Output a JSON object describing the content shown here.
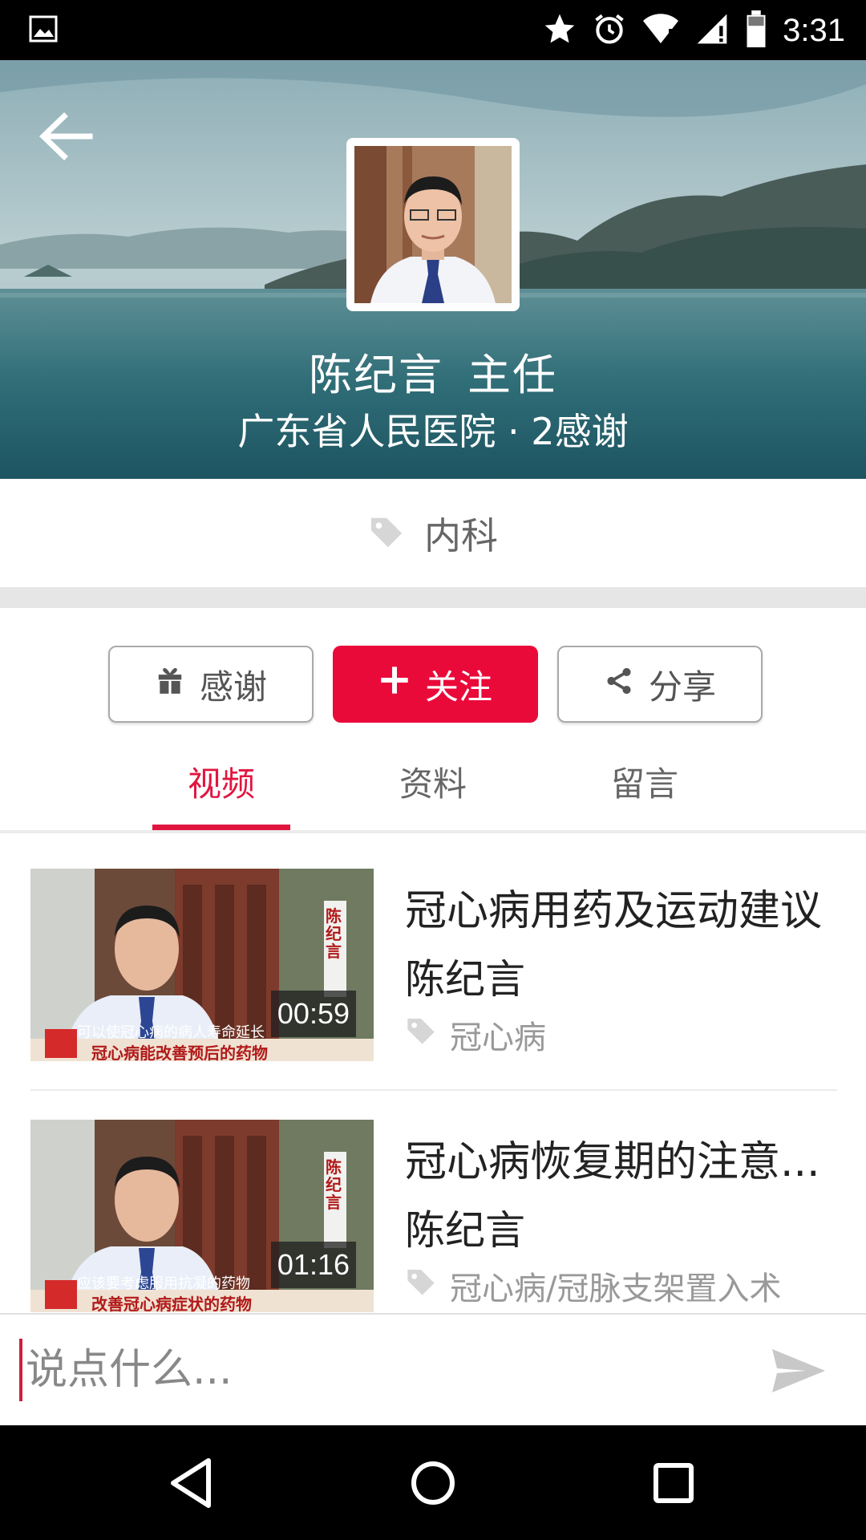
{
  "status_bar": {
    "time": "3:31",
    "icons": [
      "image-icon",
      "star-icon",
      "alarm-icon",
      "wifi-icon",
      "signal-icon",
      "battery-icon"
    ]
  },
  "header": {
    "doctor_name": "陈纪言",
    "doctor_title": "主任",
    "hospital": "广东省人民医院",
    "separator": "·",
    "thanks_count": "2感谢"
  },
  "department": {
    "label": "内科",
    "icon": "tag-icon"
  },
  "actions": {
    "thank_label": "感谢",
    "follow_label": "关注",
    "share_label": "分享"
  },
  "tabs": [
    {
      "label": "视频",
      "active": true
    },
    {
      "label": "资料",
      "active": false
    },
    {
      "label": "留言",
      "active": false
    }
  ],
  "videos": [
    {
      "title": "冠心病用药及运动建议",
      "author": "陈纪言",
      "tag": "冠心病",
      "duration": "00:59",
      "caption_top": "可以使冠心病的病人寿命延长",
      "caption_bottom": "冠心病能改善预后的药物",
      "side_text": "陈纪言"
    },
    {
      "title": "冠心病恢复期的注意...",
      "author": "陈纪言",
      "tag": "冠心病/冠脉支架置入术",
      "duration": "01:16",
      "caption_top": "应该要考虑服用抗凝的药物",
      "caption_bottom": "改善冠心病症状的药物",
      "side_text": "陈纪言"
    }
  ],
  "comment": {
    "placeholder": "说点什么..."
  },
  "colors": {
    "accent": "#e0163f",
    "follow_bg": "#ea0a3a"
  }
}
